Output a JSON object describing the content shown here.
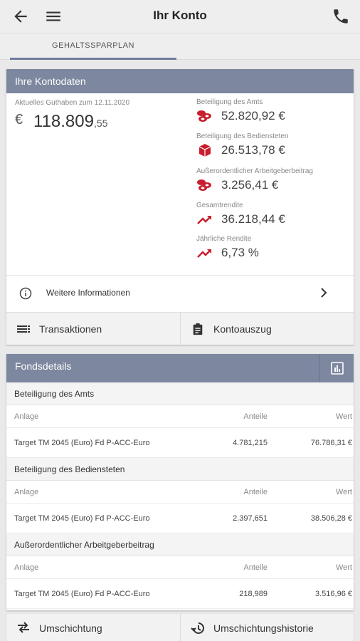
{
  "appbar": {
    "title": "Ihr Konto",
    "back_icon": "arrow-back-icon",
    "menu_icon": "menu-icon",
    "phone_icon": "phone-icon"
  },
  "tabs": [
    {
      "label": "GEHALTSSPARPLAN",
      "active": true
    }
  ],
  "accent_color": "#7d879f",
  "icon_red": "#c81e2d",
  "kontodaten": {
    "header": "Ihre Kontodaten",
    "balance_label": "Aktuelles Guthaben zum 12.11.2020",
    "currency": "€",
    "balance_main": "118.809",
    "balance_cents": ",55",
    "items": [
      {
        "label": "Beteiligung des Amts",
        "value": "52.820,92 €",
        "icon": "coins-icon"
      },
      {
        "label": "Beteiligung des Bediensteten",
        "value": "26.513,78 €",
        "icon": "box-icon"
      },
      {
        "label": "Außerordentlicher Arbeitgeberbeitrag",
        "value": "3.256,41 €",
        "icon": "coins-icon"
      },
      {
        "label": "Gesamtrendite",
        "value": "36.218,44 €",
        "icon": "trending-up-icon"
      },
      {
        "label": "Jährliche Rendite",
        "value": "6,73 %",
        "icon": "trending-up-icon"
      }
    ],
    "more_label": "Weitere Informationen",
    "actions": {
      "transactions": "Transaktionen",
      "statement": "Kontoauszug"
    }
  },
  "fondsdetails": {
    "header": "Fondsdetails",
    "columns": {
      "anlage": "Anlage",
      "anteile": "Anteile",
      "wert": "Wert"
    },
    "groups": [
      {
        "title": "Beteiligung des Amts",
        "rows": [
          {
            "anlage": "Target TM 2045 (Euro) Fd P-ACC-Euro",
            "anteile": "4.781,215",
            "wert": "76.786,31 €"
          }
        ]
      },
      {
        "title": "Beteiligung des Bediensteten",
        "rows": [
          {
            "anlage": "Target TM 2045 (Euro) Fd P-ACC-Euro",
            "anteile": "2.397,651",
            "wert": "38.506,28 €"
          }
        ]
      },
      {
        "title": "Außerordentlicher Arbeitgeberbeitrag",
        "rows": [
          {
            "anlage": "Target TM 2045 (Euro) Fd P-ACC-Euro",
            "anteile": "218,989",
            "wert": "3.516,96 €"
          }
        ]
      }
    ]
  },
  "bottom_actions": {
    "reallocation": "Umschichtung",
    "history": "Umschichtungshistorie"
  }
}
